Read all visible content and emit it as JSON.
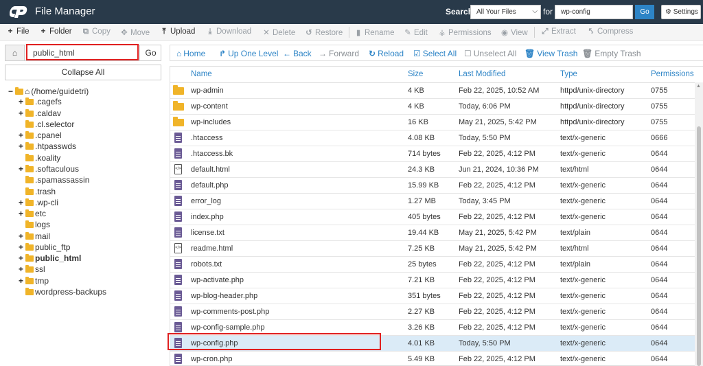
{
  "header": {
    "title": "File Manager",
    "search_label": "Search",
    "search_scope": "All Your Files",
    "for_label": "for",
    "search_value": "wp-config",
    "go_label": "Go",
    "settings_label": "Settings"
  },
  "toolbar": {
    "file": "File",
    "folder": "Folder",
    "copy": "Copy",
    "move": "Move",
    "upload": "Upload",
    "download": "Download",
    "delete": "Delete",
    "restore": "Restore",
    "rename": "Rename",
    "edit": "Edit",
    "permissions": "Permissions",
    "view": "View",
    "extract": "Extract",
    "compress": "Compress"
  },
  "left": {
    "path_value": "public_html",
    "go_label": "Go",
    "collapse_label": "Collapse All",
    "tree": [
      {
        "label": "(/home/guidetri)",
        "toggle": "−",
        "root": true
      },
      {
        "label": ".cagefs",
        "toggle": "+"
      },
      {
        "label": ".caldav",
        "toggle": "+"
      },
      {
        "label": ".cl.selector",
        "toggle": ""
      },
      {
        "label": ".cpanel",
        "toggle": "+"
      },
      {
        "label": ".htpasswds",
        "toggle": "+"
      },
      {
        "label": ".koality",
        "toggle": ""
      },
      {
        "label": ".softaculous",
        "toggle": "+"
      },
      {
        "label": ".spamassassin",
        "toggle": ""
      },
      {
        "label": ".trash",
        "toggle": ""
      },
      {
        "label": ".wp-cli",
        "toggle": "+"
      },
      {
        "label": "etc",
        "toggle": "+"
      },
      {
        "label": "logs",
        "toggle": ""
      },
      {
        "label": "mail",
        "toggle": "+"
      },
      {
        "label": "public_ftp",
        "toggle": "+"
      },
      {
        "label": "public_html",
        "toggle": "+",
        "bold": true
      },
      {
        "label": "ssl",
        "toggle": "+"
      },
      {
        "label": "tmp",
        "toggle": "+"
      },
      {
        "label": "wordpress-backups",
        "toggle": ""
      }
    ]
  },
  "nav": {
    "home": "Home",
    "up": "Up One Level",
    "back": "Back",
    "forward": "Forward",
    "reload": "Reload",
    "select_all": "Select All",
    "unselect_all": "Unselect All",
    "view_trash": "View Trash",
    "empty_trash": "Empty Trash"
  },
  "columns": {
    "name": "Name",
    "size": "Size",
    "modified": "Last Modified",
    "type": "Type",
    "perms": "Permissions"
  },
  "files": [
    {
      "name": "wp-admin",
      "size": "4 KB",
      "modified": "Feb 22, 2025, 10:52 AM",
      "type": "httpd/unix-directory",
      "perms": "0755",
      "icon": "folder"
    },
    {
      "name": "wp-content",
      "size": "4 KB",
      "modified": "Today, 6:06 PM",
      "type": "httpd/unix-directory",
      "perms": "0755",
      "icon": "folder"
    },
    {
      "name": "wp-includes",
      "size": "16 KB",
      "modified": "May 21, 2025, 5:42 PM",
      "type": "httpd/unix-directory",
      "perms": "0755",
      "icon": "folder"
    },
    {
      "name": ".htaccess",
      "size": "4.08 KB",
      "modified": "Today, 5:50 PM",
      "type": "text/x-generic",
      "perms": "0666",
      "icon": "doc"
    },
    {
      "name": ".htaccess.bk",
      "size": "714 bytes",
      "modified": "Feb 22, 2025, 4:12 PM",
      "type": "text/x-generic",
      "perms": "0644",
      "icon": "doc"
    },
    {
      "name": "default.html",
      "size": "24.3 KB",
      "modified": "Jun 21, 2024, 10:36 PM",
      "type": "text/html",
      "perms": "0644",
      "icon": "html"
    },
    {
      "name": "default.php",
      "size": "15.99 KB",
      "modified": "Feb 22, 2025, 4:12 PM",
      "type": "text/x-generic",
      "perms": "0644",
      "icon": "doc"
    },
    {
      "name": "error_log",
      "size": "1.27 MB",
      "modified": "Today, 3:45 PM",
      "type": "text/x-generic",
      "perms": "0644",
      "icon": "doc"
    },
    {
      "name": "index.php",
      "size": "405 bytes",
      "modified": "Feb 22, 2025, 4:12 PM",
      "type": "text/x-generic",
      "perms": "0644",
      "icon": "doc"
    },
    {
      "name": "license.txt",
      "size": "19.44 KB",
      "modified": "May 21, 2025, 5:42 PM",
      "type": "text/plain",
      "perms": "0644",
      "icon": "doc"
    },
    {
      "name": "readme.html",
      "size": "7.25 KB",
      "modified": "May 21, 2025, 5:42 PM",
      "type": "text/html",
      "perms": "0644",
      "icon": "html"
    },
    {
      "name": "robots.txt",
      "size": "25 bytes",
      "modified": "Feb 22, 2025, 4:12 PM",
      "type": "text/plain",
      "perms": "0644",
      "icon": "doc"
    },
    {
      "name": "wp-activate.php",
      "size": "7.21 KB",
      "modified": "Feb 22, 2025, 4:12 PM",
      "type": "text/x-generic",
      "perms": "0644",
      "icon": "doc"
    },
    {
      "name": "wp-blog-header.php",
      "size": "351 bytes",
      "modified": "Feb 22, 2025, 4:12 PM",
      "type": "text/x-generic",
      "perms": "0644",
      "icon": "doc"
    },
    {
      "name": "wp-comments-post.php",
      "size": "2.27 KB",
      "modified": "Feb 22, 2025, 4:12 PM",
      "type": "text/x-generic",
      "perms": "0644",
      "icon": "doc"
    },
    {
      "name": "wp-config-sample.php",
      "size": "3.26 KB",
      "modified": "Feb 22, 2025, 4:12 PM",
      "type": "text/x-generic",
      "perms": "0644",
      "icon": "doc"
    },
    {
      "name": "wp-config.php",
      "size": "4.01 KB",
      "modified": "Today, 5:50 PM",
      "type": "text/x-generic",
      "perms": "0644",
      "icon": "doc",
      "selected": true
    },
    {
      "name": "wp-cron.php",
      "size": "5.49 KB",
      "modified": "Feb 22, 2025, 4:12 PM",
      "type": "text/x-generic",
      "perms": "0644",
      "icon": "doc"
    }
  ],
  "colors": {
    "header_bg": "#293a4a",
    "accent": "#2d84c6",
    "highlight": "#e02020",
    "selected_row": "#dbebf7",
    "folder": "#f0b429",
    "file_icon": "#6b5b95"
  }
}
